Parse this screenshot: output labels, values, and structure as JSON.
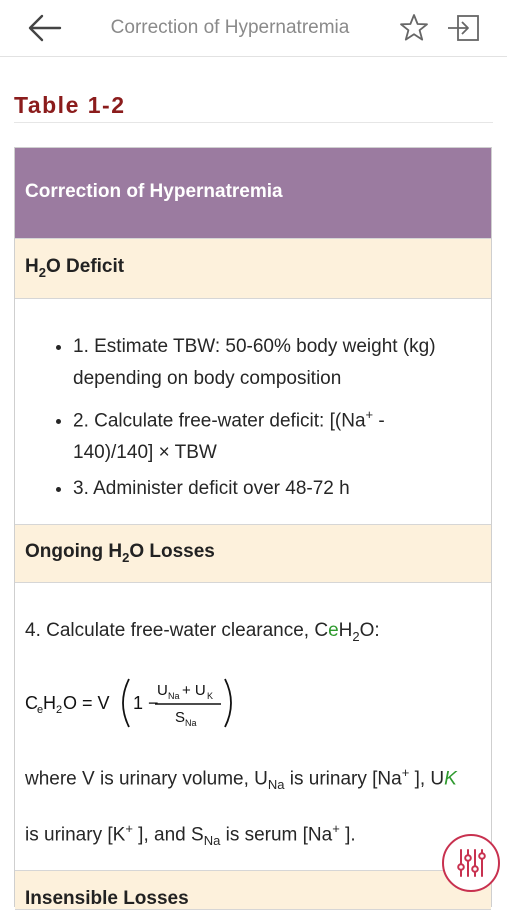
{
  "header": {
    "title": "Correction of Hypernatremia",
    "back_icon": "arrow-left-icon",
    "favorite_icon": "star-outline-icon",
    "exit_icon": "exit-icon"
  },
  "table_label": "Table 1-2",
  "table": {
    "title": "Correction of Hypernatremia",
    "sections": [
      {
        "heading": {
          "pre": "H",
          "sub": "2",
          "post": "O Deficit"
        },
        "bullets": [
          "1. Estimate TBW: 50-60% body weight (kg) depending on body composition",
          {
            "pre": "2. Calculate free-water deficit: [(Na",
            "sup": "+",
            "post": " - 140)/140] × TBW"
          },
          "3. Administer deficit over 48-72 h"
        ]
      },
      {
        "heading": {
          "pre": "Ongoing H",
          "sub": "2",
          "post": "O Losses"
        },
        "step": {
          "pre": "4. Calculate free-water clearance, C",
          "e": "e",
          "mid": "H",
          "sub": "2",
          "post": "O:"
        },
        "formula": {
          "lhs_c": "C",
          "lhs_e": "e",
          "lhs_h": "H",
          "lhs_2": "2",
          "lhs_o": "O = V",
          "one_minus": "1 −",
          "num_u1": "U",
          "num_na": "Na",
          "num_plus": "+ U",
          "num_k": "K",
          "den_s": "S",
          "den_na": "Na"
        },
        "where": {
          "t1": "where V is urinary volume, U",
          "s1": "Na",
          "t2": " is urinary [Na",
          "sup1": "+",
          "t3": " ], U",
          "k": "K",
          "t4": "is urinary [K",
          "sup2": "+",
          "t5": " ], and S",
          "s2": "Na",
          "t6": " is serum [Na",
          "sup3": "+",
          "t7": " ]."
        }
      },
      {
        "heading_text": "Insensible Losses"
      }
    ]
  },
  "fab": {
    "icon": "sliders-icon"
  },
  "colors": {
    "title_red": "#8b1c1c",
    "table_header": "#9b7ba0",
    "section_bg": "#fdf1dc",
    "fab_accent": "#c8314f",
    "subscript_green": "#2e9a2e"
  }
}
